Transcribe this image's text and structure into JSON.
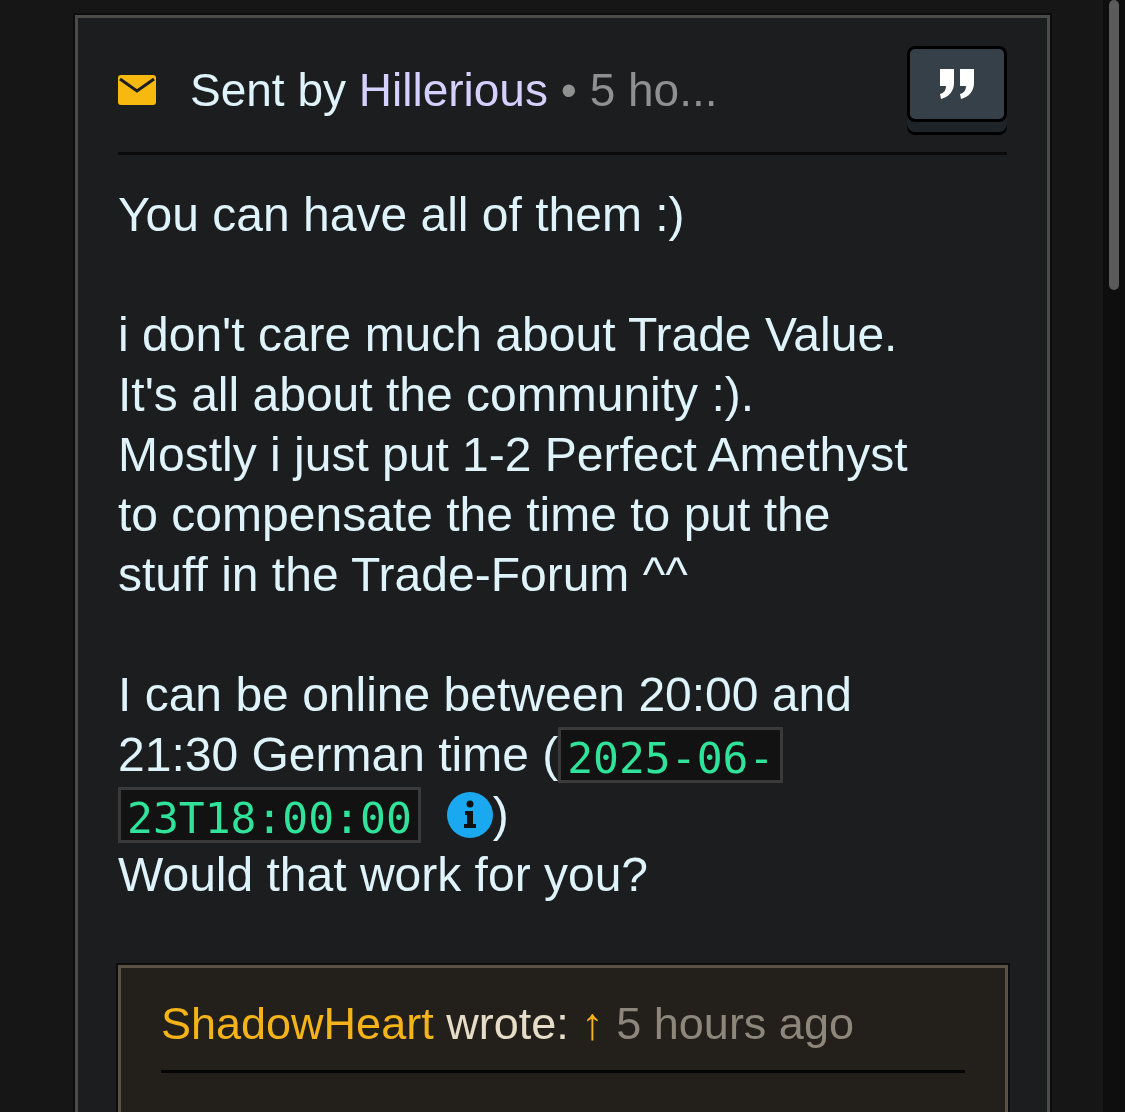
{
  "message": {
    "sender_prefix": "Sent by",
    "sender": "Hillerious",
    "separator": "•",
    "time": "5 ho...",
    "paragraphs": [
      {
        "kind": "text",
        "text": "You can have all of them :)"
      },
      {
        "kind": "text",
        "text": "i don't care much about Trade Value.\nIt's all about the community :).\nMostly i just put 1-2 Perfect Amethyst\nto compensate the time to put the\nstuff in the Trade-Forum ^^"
      },
      {
        "kind": "time",
        "first": "I can be online between 20:00 and",
        "before": "21:30 German time (",
        "timestamp_start": "2025-06-",
        "timestamp_end": "23T18:00:00",
        "after": ")",
        "last": "Would that work for you?"
      }
    ]
  },
  "quote": {
    "author": "ShadowHeart",
    "verb": "wrote:",
    "arrow": "↑",
    "time": "5 hours ago"
  }
}
